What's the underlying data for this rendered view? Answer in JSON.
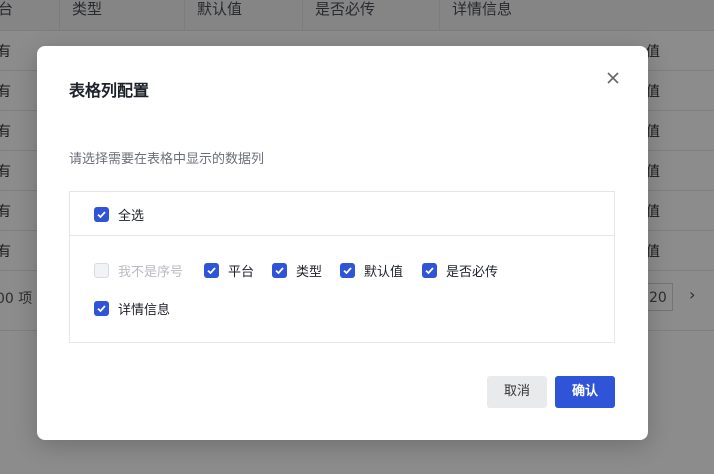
{
  "background": {
    "headers": [
      "台",
      "类型",
      "默认值",
      "是否必传",
      "详情信息"
    ],
    "row_left_text": "有",
    "row_right_text": "值",
    "footer_left": "00 项",
    "page_size": "20",
    "next_icon": "chevron-right-icon"
  },
  "modal": {
    "title": "表格列配置",
    "close_icon": "close-icon",
    "hint": "请选择需要在表格中显示的数据列",
    "select_all": {
      "label": "全选",
      "checked": true
    },
    "columns": [
      {
        "label": "我不是序号",
        "checked": false,
        "disabled": true
      },
      {
        "label": "平台",
        "checked": true,
        "disabled": false
      },
      {
        "label": "类型",
        "checked": true,
        "disabled": false
      },
      {
        "label": "默认值",
        "checked": true,
        "disabled": false
      },
      {
        "label": "是否必传",
        "checked": true,
        "disabled": false
      },
      {
        "label": "详情信息",
        "checked": true,
        "disabled": false
      }
    ],
    "cancel_label": "取消",
    "confirm_label": "确认"
  },
  "colors": {
    "accent": "#2f54d8",
    "overlay": "rgba(0,0,0,0.45)"
  }
}
